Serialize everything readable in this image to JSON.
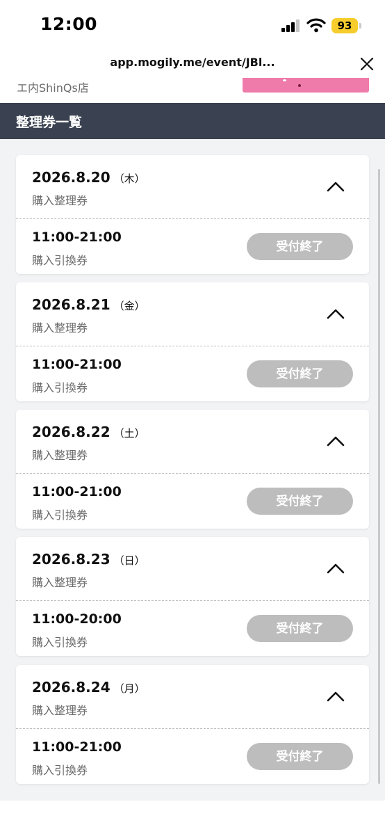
{
  "status_bar": {
    "time": "12:00",
    "battery": "93"
  },
  "browser": {
    "url": "app.mogily.me/event/JBl...",
    "close_icon": "close-icon"
  },
  "page_header": {
    "store_name": "エ内ShinQs店"
  },
  "section": {
    "title": "整理券一覧"
  },
  "colors": {
    "header_bg": "#3a4150",
    "disabled_button": "#bdbdbd",
    "list_bg": "#f2f3f5",
    "battery": "#f6cd2c"
  },
  "days": [
    {
      "date": "2026.8.20",
      "weekday": "（木）",
      "type": "購入整理券",
      "time": "11:00-21:00",
      "slot_type": "購入引換券",
      "status": "受付終了",
      "icon": "chevron-up-icon"
    },
    {
      "date": "2026.8.21",
      "weekday": "（金）",
      "type": "購入整理券",
      "time": "11:00-21:00",
      "slot_type": "購入引換券",
      "status": "受付終了",
      "icon": "chevron-up-icon"
    },
    {
      "date": "2026.8.22",
      "weekday": "（土）",
      "type": "購入整理券",
      "time": "11:00-21:00",
      "slot_type": "購入引換券",
      "status": "受付終了",
      "icon": "chevron-up-icon"
    },
    {
      "date": "2026.8.23",
      "weekday": "（日）",
      "type": "購入整理券",
      "time": "11:00-20:00",
      "slot_type": "購入引換券",
      "status": "受付終了",
      "icon": "chevron-up-icon"
    },
    {
      "date": "2026.8.24",
      "weekday": "（月）",
      "type": "購入整理券",
      "time": "11:00-21:00",
      "slot_type": "購入引換券",
      "status": "受付終了",
      "icon": "chevron-up-icon"
    }
  ]
}
